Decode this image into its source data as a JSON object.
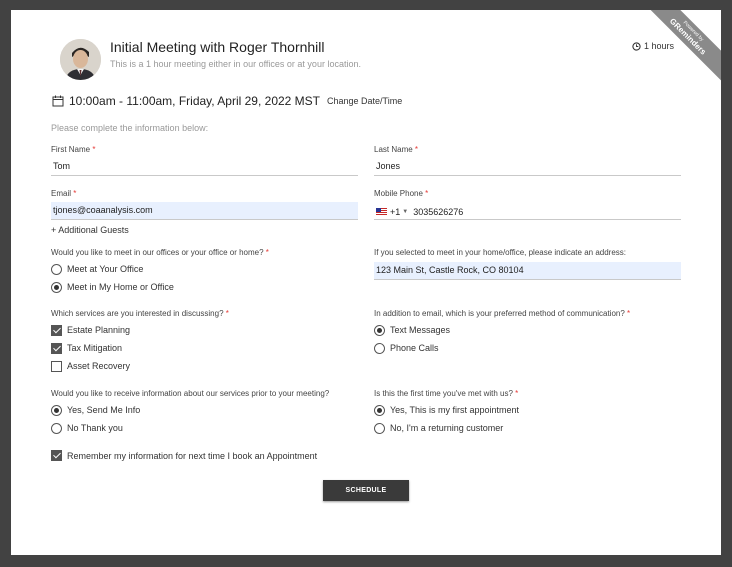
{
  "ribbon": {
    "top": "Powered by",
    "main": "GReminders"
  },
  "event": {
    "title": "Initial Meeting with Roger Thornhill",
    "subtitle": "This is a 1 hour meeting either in our offices or at your location.",
    "duration": "1 hours",
    "datetime": "10:00am - 11:00am, Friday, April 29, 2022 MST",
    "change_link": "Change Date/Time"
  },
  "form": {
    "intro": "Please complete the information below:",
    "first_name": {
      "label": "First Name",
      "value": "Tom"
    },
    "last_name": {
      "label": "Last Name",
      "value": "Jones"
    },
    "email": {
      "label": "Email",
      "value": "tjones@coaanalysis.com"
    },
    "phone": {
      "label": "Mobile Phone",
      "code": "+1",
      "value": "3035626276"
    },
    "additional_guests": "+ Additional Guests",
    "meet_location": {
      "label": "Would you like to meet in our offices or your office or home?",
      "options": [
        "Meet at Your Office",
        "Meet in My Home or Office"
      ],
      "selected": 1
    },
    "address": {
      "label": "If you selected to meet in your home/office, please indicate an address:",
      "value": "123 Main St, Castle Rock, CO 80104"
    },
    "services": {
      "label": "Which services are you interested in discussing?",
      "options": [
        "Estate Planning",
        "Tax Mitigation",
        "Asset Recovery"
      ],
      "checked": [
        true,
        true,
        false
      ]
    },
    "communication": {
      "label": "In addition to email, which is your preferred method of communication?",
      "options": [
        "Text Messages",
        "Phone Calls"
      ],
      "selected": 0
    },
    "info_prior": {
      "label": "Would you like to receive information about our services prior to your meeting?",
      "options": [
        "Yes, Send Me Info",
        "No Thank you"
      ],
      "selected": 0
    },
    "first_time": {
      "label": "Is this the first time you've met with us?",
      "options": [
        "Yes, This is my first appointment",
        "No, I'm a returning customer"
      ],
      "selected": 0
    },
    "remember": {
      "label": "Remember my information for next time I book an Appointment",
      "checked": true
    },
    "submit": "SCHEDULE"
  },
  "colors": {
    "background": "#424242",
    "required": "#e53935",
    "button": "#3a3a3a",
    "autofill": "#e8f0fe"
  }
}
